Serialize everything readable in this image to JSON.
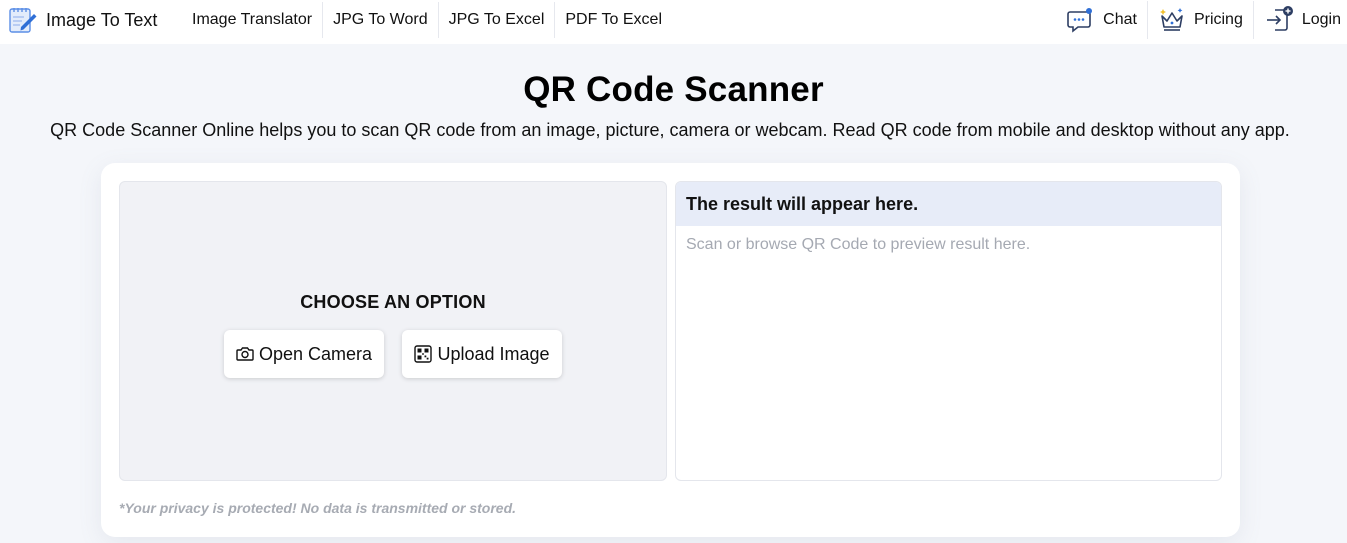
{
  "header": {
    "brand": {
      "label": "Image To Text",
      "icon": "notepad-pencil-icon"
    },
    "nav": [
      {
        "label": "Image Translator"
      },
      {
        "label": "JPG To Word"
      },
      {
        "label": "JPG To Excel"
      },
      {
        "label": "PDF To Excel"
      }
    ],
    "right_nav": [
      {
        "label": "Chat",
        "icon": "chat-bubble-icon"
      },
      {
        "label": "Pricing",
        "icon": "crown-icon"
      },
      {
        "label": "Login",
        "icon": "login-icon"
      }
    ]
  },
  "page": {
    "title": "QR Code Scanner",
    "subtitle": "QR Code Scanner Online helps you to scan QR code from an image, picture, camera or webcam. Read QR code from mobile and desktop without any app."
  },
  "scanner": {
    "choose_heading": "CHOOSE AN OPTION",
    "open_camera_label": "Open Camera",
    "open_camera_icon": "camera-icon",
    "upload_image_label": "Upload Image",
    "upload_image_icon": "qr-code-icon"
  },
  "result": {
    "header": "The result will appear here.",
    "placeholder": "Scan or browse QR Code to preview result here."
  },
  "privacy_note": "*Your privacy is protected! No data is transmitted or stored.",
  "colors": {
    "accent_blue": "#2f6fd6",
    "result_header_bg": "#e7ecf8",
    "page_bg": "#f4f6fa",
    "scan_panel_bg": "#f1f2f6"
  }
}
